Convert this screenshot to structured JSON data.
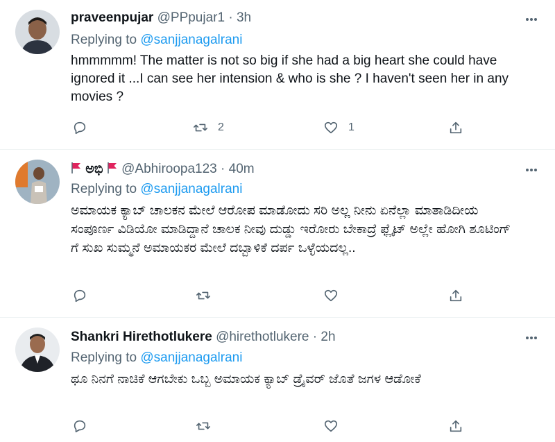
{
  "tweets": [
    {
      "name": "praveenpujar",
      "handle": "@PPpujar1",
      "separator": "·",
      "time": "3h",
      "replying_prefix": "Replying to",
      "replying_to": "@sanjjanagalrani",
      "text": "hmmmmm! The matter is not so big if she had a big heart she could have ignored it ...I can see her intension &  who is she ? I haven't seen her in any movies ?",
      "retweets": "2",
      "likes": "1"
    },
    {
      "name": "ಅಭಿ",
      "handle": "@Abhiroopa123",
      "separator": "·",
      "time": "40m",
      "replying_prefix": "Replying to",
      "replying_to": "@sanjjanagalrani",
      "text": "ಅಮಾಯಕ ಕ್ಯಾಬ್ ಚಾಲಕನ ಮೇಲೆ ಆರೋಪ ಮಾಡೋದು ಸರಿ ಅಲ್ಲ ನೀನು ಏನೆಲ್ಲಾ ಮಾತಾಡಿದೀಯ ಸಂಪೂರ್ಣ ವಿಡಿಯೋ ಮಾಡಿದ್ದಾನೆ ಚಾಲಕ ನೀವು ದುಡ್ಡು ಇರೋರು ಬೇಕಾದ್ರೆ ಫ್ಲೈಟ್ ಅಲ್ಲೇ ಹೋಗಿ ಶೂಟಿಂಗ್ ಗೆ ಸುಖ ಸುಮ್ಮನೆ ಅಮಾಯಕರ ಮೇಲೆ ದಬ್ಬಾಳಿಕೆ ದರ್ಪ ಒಳ್ಳೆಯದಲ್ಲ..",
      "retweets": "",
      "likes": ""
    },
    {
      "name": "Shankri Hirethotlukere",
      "handle": "@hirethotlukere",
      "separator": "·",
      "time": "2h",
      "replying_prefix": "Replying to",
      "replying_to": "@sanjjanagalrani",
      "text": "ಥೂ ನಿನಗೆ ನಾಚಿಕೆ ಆಗಬೇಕು ಒಬ್ಬ ಅಮಾಯಕ ಕ್ಯಾಬ್ ಡ್ರೈವರ್ ಜೊತೆ ಜಗಳ ಆಡೋಕೆ",
      "retweets": "",
      "likes": ""
    }
  ],
  "icons": {
    "reply": "reply-icon",
    "retweet": "retweet-icon",
    "like": "heart-icon",
    "share": "share-icon",
    "more": "more-icon",
    "flag": "red-flag-icon"
  },
  "colors": {
    "link": "#1d9bf0",
    "secondary": "#536471",
    "divider": "#eff3f4",
    "flag": "#e0245e"
  }
}
